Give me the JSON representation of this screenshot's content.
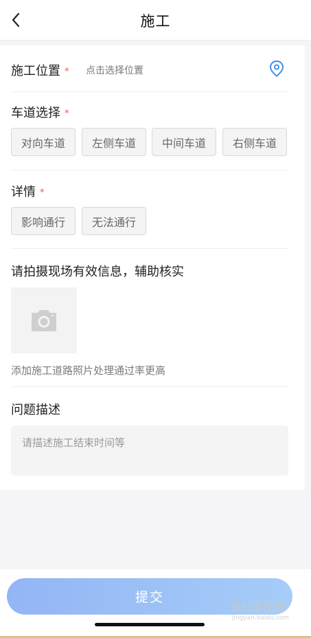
{
  "header": {
    "title": "施工"
  },
  "form": {
    "location": {
      "label": "施工位置",
      "required_mark": "*",
      "placeholder": "点击选择位置"
    },
    "lane": {
      "label": "车道选择",
      "required_mark": "*",
      "options": [
        "对向车道",
        "左侧车道",
        "中间车道",
        "右侧车道"
      ]
    },
    "detail": {
      "label": "详情",
      "required_mark": "*",
      "options": [
        "影响通行",
        "无法通行"
      ]
    },
    "photo": {
      "label": "请拍摄现场有效信息，辅助核实",
      "tip": "添加施工道路照片处理通过率更高"
    },
    "description": {
      "label": "问题描述",
      "placeholder": "请描述施工结束时间等"
    }
  },
  "footer": {
    "submit_label": "提交"
  },
  "watermark": {
    "brand": "Bai度经验",
    "url": "jingyan.baidu.com"
  },
  "colors": {
    "accent": "#3d8ef0",
    "required": "#e8584c",
    "submit_gradient": [
      "#93b5f5",
      "#a6cdf8"
    ]
  },
  "icons": {
    "back": "chevron-left-icon",
    "location": "map-pin-icon",
    "camera": "camera-icon"
  }
}
